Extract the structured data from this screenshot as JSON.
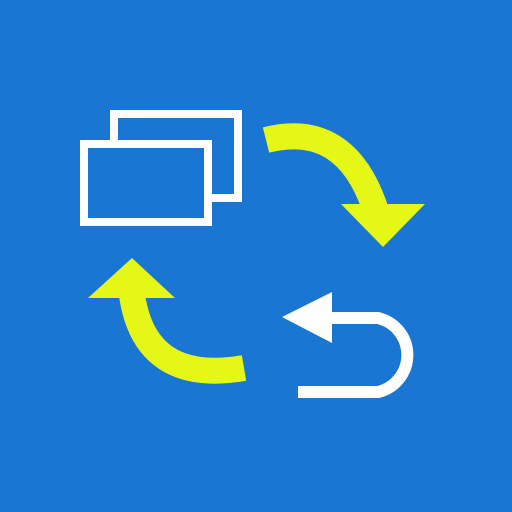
{
  "icon": {
    "name": "app-icon",
    "background_color": "#1976D2",
    "white_color": "#FFFFFF",
    "accent_color": "#E4F716",
    "glyphs": [
      "windows-stack-icon",
      "clockwise-arrow-icon",
      "counterclockwise-arrow-icon",
      "undo-arrow-icon"
    ]
  }
}
